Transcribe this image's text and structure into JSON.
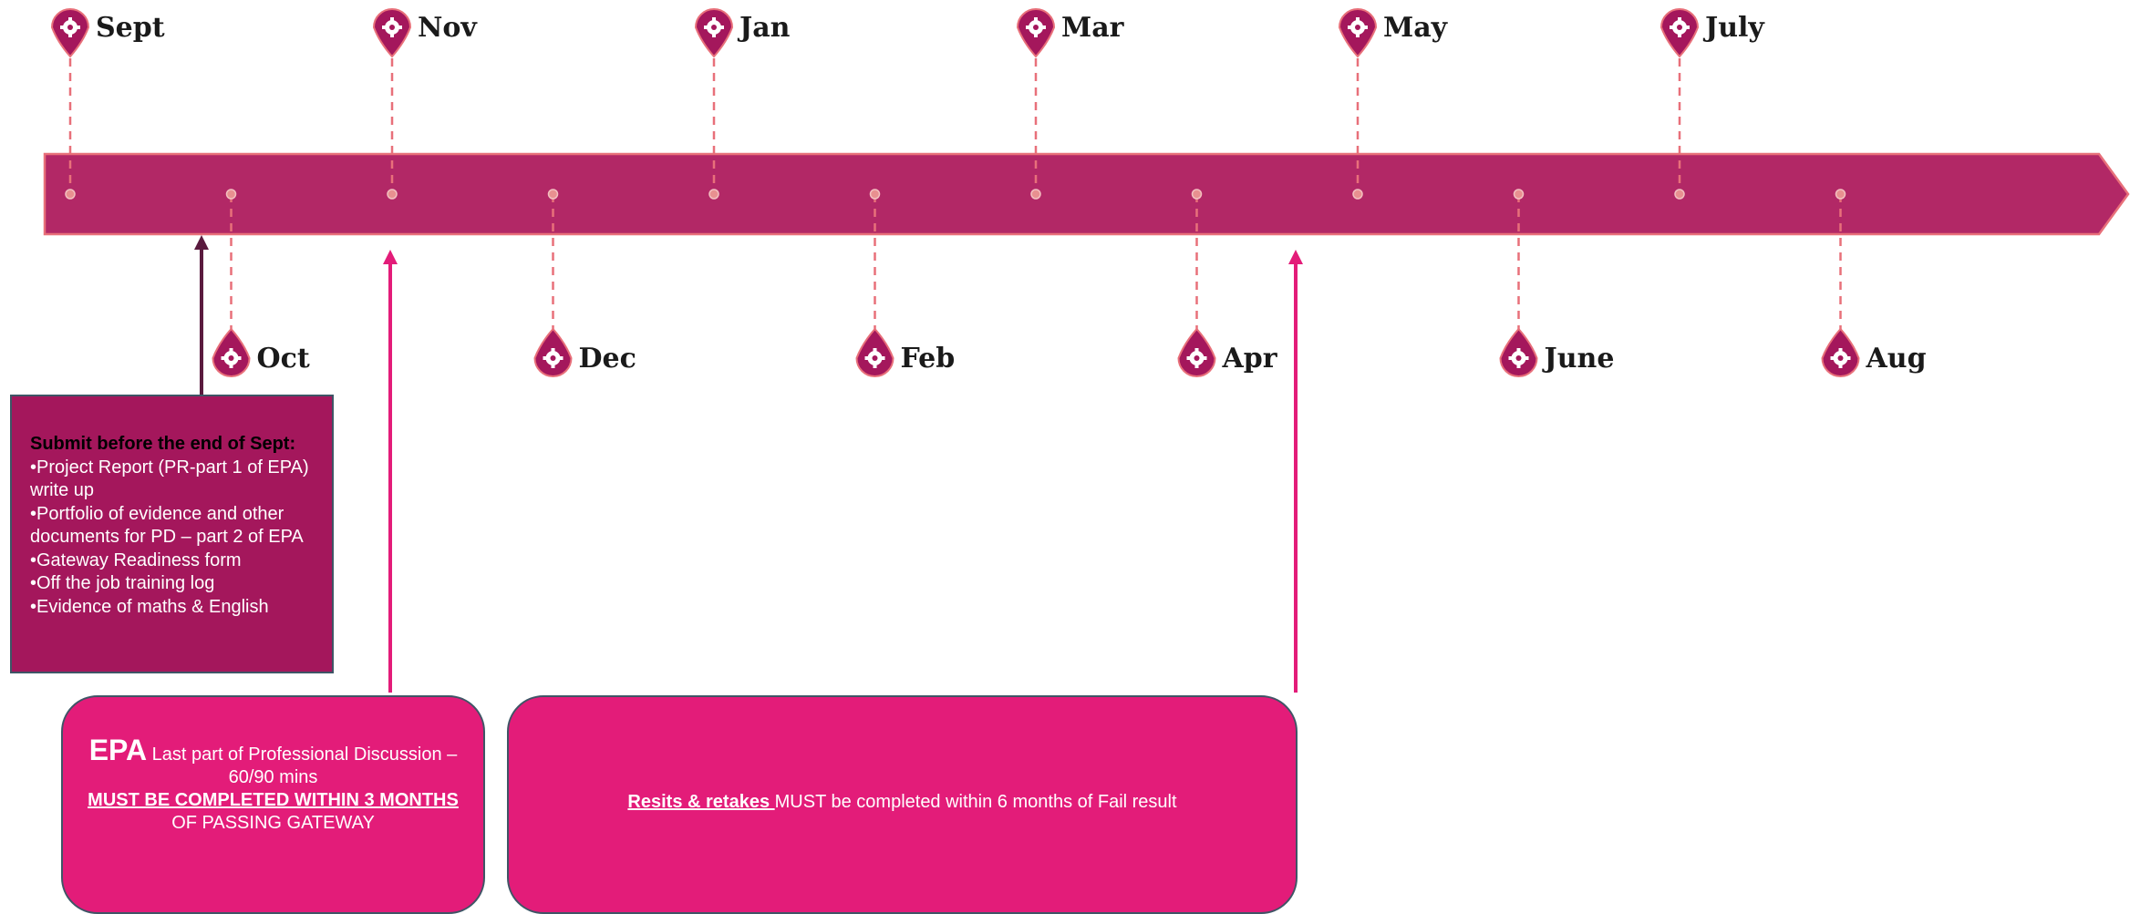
{
  "timeline": {
    "months_top": [
      "Sept",
      "Nov",
      "Jan",
      "Mar",
      "May",
      "July"
    ],
    "months_bottom": [
      "Oct",
      "Dec",
      "Feb",
      "Apr",
      "June",
      "Aug"
    ]
  },
  "submit_box": {
    "title": "Submit before the end of Sept:",
    "items": [
      "•Project Report (PR-part 1 of EPA) write up",
      "•Portfolio of evidence and other documents for PD – part 2 of EPA",
      "•Gateway Readiness form",
      "•Off the job training log",
      "•Evidence of maths & English"
    ]
  },
  "epa_box": {
    "big": "EPA",
    "text": " Last part of Professional Discussion – 60/90 mins",
    "warn": "MUST BE COMPLETED WITHIN 3 MONTHS ",
    "tail": "OF PASSING GATEWAY"
  },
  "resit_box": {
    "title": "Resits & retakes ",
    "text": "MUST be completed within 6 months of Fail result"
  },
  "colors": {
    "band": "#b22866",
    "band_border": "#e8707a",
    "pin": "#a4175c",
    "dash": "#e8707a",
    "box_pink": "#e31c79",
    "box_dark": "#a4175c",
    "arrow_dark": "#5a1a3e",
    "arrow_pink": "#e31c79"
  }
}
